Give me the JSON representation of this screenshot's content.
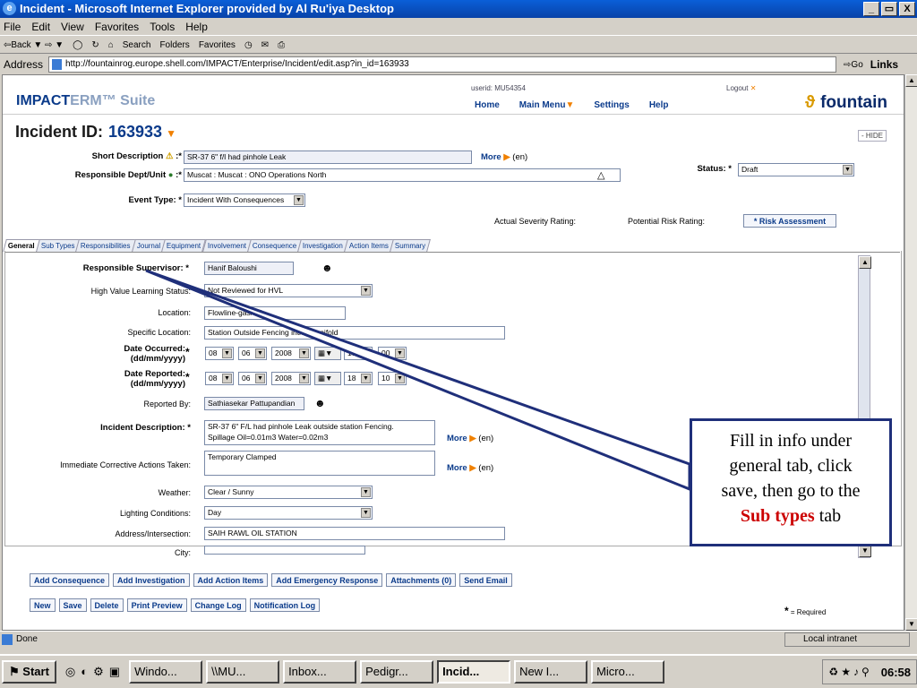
{
  "window": {
    "title": "Incident - Microsoft Internet Explorer provided by Al Ru'iya Desktop",
    "min": "_",
    "max": "̅",
    "close": "X"
  },
  "menu": [
    "File",
    "Edit",
    "View",
    "Favorites",
    "Tools",
    "Help"
  ],
  "toolbar": {
    "back": "⇦Back ▼ ⇨ ▼",
    "search": "Search",
    "folders": "Folders",
    "favorites": "Favorites"
  },
  "address": {
    "label": "Address",
    "url": "http://fountainrog.europe.shell.com/IMPACT/Enterprise/Incident/edit.asp?in_id=163933",
    "go": "Go",
    "links": "Links"
  },
  "app": {
    "logo_main": "IMPACT",
    "logo_erm": "ERM™ Suite",
    "userid": "userid: MU54354",
    "logout": "Logout",
    "nav": [
      "Home",
      "Main Menu",
      "Settings",
      "Help"
    ],
    "brand": "fountain"
  },
  "incident": {
    "label": "Incident ID:",
    "id": "163933",
    "hide": "- HIDE"
  },
  "top_form": {
    "short_desc_label": "Short Description",
    "short_desc": "SR-37 6\" f/l had pinhole Leak",
    "resp_label": "Responsible Dept/Unit",
    "resp": "Muscat : Muscat : ONO Operations North",
    "event_label": "Event Type:",
    "event": "Incident With Consequences",
    "status_label": "Status:",
    "status": "Draft",
    "actual_sev": "Actual Severity Rating:",
    "potential_risk": "Potential Risk Rating:",
    "risk_btn": "* Risk Assessment",
    "more": "More",
    "en": "(en)",
    "star": ":*"
  },
  "tabs": [
    "General",
    "Sub Types",
    "Responsibilities",
    "Journal",
    "Equipment",
    "Involvement",
    "Consequence",
    "Investigation",
    "Action Items",
    "Summary"
  ],
  "general": {
    "sup_label": "Responsible Supervisor:",
    "sup": "Hanif Baloushi",
    "hvl_label": "High Value Learning Status:",
    "hvl": "Not Reviewed for HVL",
    "loc_label": "Location:",
    "loc": "Flowline-gas/Oil",
    "sloc_label": "Specific Location:",
    "sloc": "Station Outside Fencing intlet Manifold",
    "occ_label": "Date Occurred:",
    "rep_label": "Date Reported:",
    "date_fmt": "(dd/mm/yyyy)",
    "occ": {
      "d": "08",
      "m": "06",
      "y": "2008",
      "h": "18",
      "mi": "00"
    },
    "rep": {
      "d": "08",
      "m": "06",
      "y": "2008",
      "h": "18",
      "mi": "10"
    },
    "repby_label": "Reported By:",
    "repby": "Sathiasekar Pattupandian",
    "desc_label": "Incident Description:",
    "desc1": "SR-37 6\" F/L had pinhole Leak outside station Fencing.",
    "desc2": "Spillage Oil=0.01m3 Water=0.02m3",
    "ica_label": "Immediate Corrective Actions Taken:",
    "ica": "Temporary Clamped",
    "weather_label": "Weather:",
    "weather": "Clear / Sunny",
    "light_label": "Lighting Conditions:",
    "light": "Day",
    "addr_label": "Address/Intersection:",
    "addr": "SAIH RAWL OIL STATION",
    "city_label": "City:"
  },
  "buttons_row1": [
    "Add Consequence",
    "Add Investigation",
    "Add Action Items",
    "Add Emergency Response",
    "Attachments (0)",
    "Send Email"
  ],
  "buttons_row2": [
    "New",
    "Save",
    "Delete",
    "Print Preview",
    "Change Log",
    "Notification Log"
  ],
  "required_note": "= Required",
  "callout": {
    "line1": "Fill in info under",
    "line2": "general tab, click",
    "line3": "save, then go to the",
    "red": "Sub types",
    "tail": " tab"
  },
  "status_bar": {
    "done": "Done",
    "zone": "Local intranet"
  },
  "taskbar": {
    "start": "Start",
    "tasks": [
      "Windo...",
      "\\\\MU...",
      "Inbox...",
      "Pedigr...",
      "Incid...",
      "New I...",
      "Micro..."
    ],
    "clock": "06:58"
  }
}
